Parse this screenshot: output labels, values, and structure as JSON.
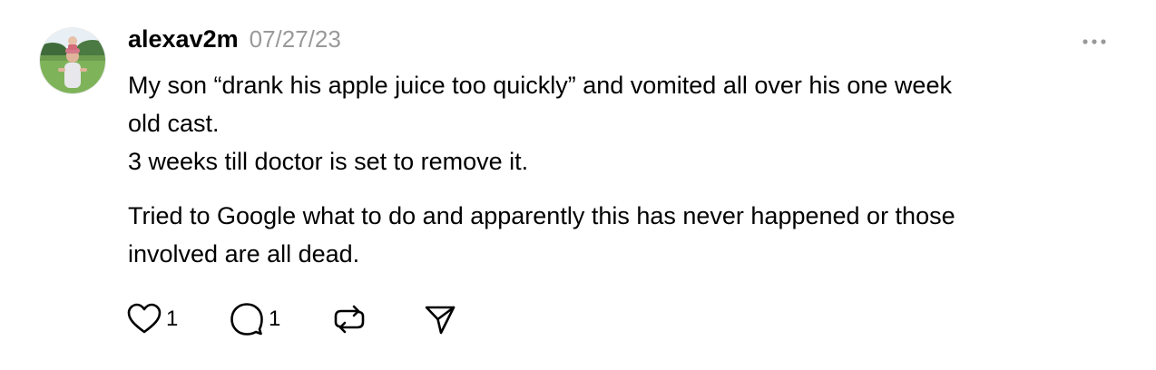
{
  "post": {
    "username": "alexav2m",
    "timestamp": "07/27/23",
    "avatar_icon": "user-avatar-photo",
    "more_icon": "more-horizontal-icon",
    "body": {
      "line1": "My son “drank his apple juice too quickly” and vomited all over his one week",
      "line2": "old cast.",
      "line3": "3 weeks till doctor is set to remove it.",
      "line4": "Tried to Google what to do and apparently this has never happened or those",
      "line5": "involved are all dead."
    },
    "actions": {
      "like_icon": "heart-icon",
      "like_count": "1",
      "reply_icon": "comment-icon",
      "reply_count": "1",
      "repost_icon": "repost-icon",
      "share_icon": "send-icon"
    },
    "colors": {
      "text": "#000000",
      "muted": "#999999",
      "icon": "#000000"
    }
  }
}
